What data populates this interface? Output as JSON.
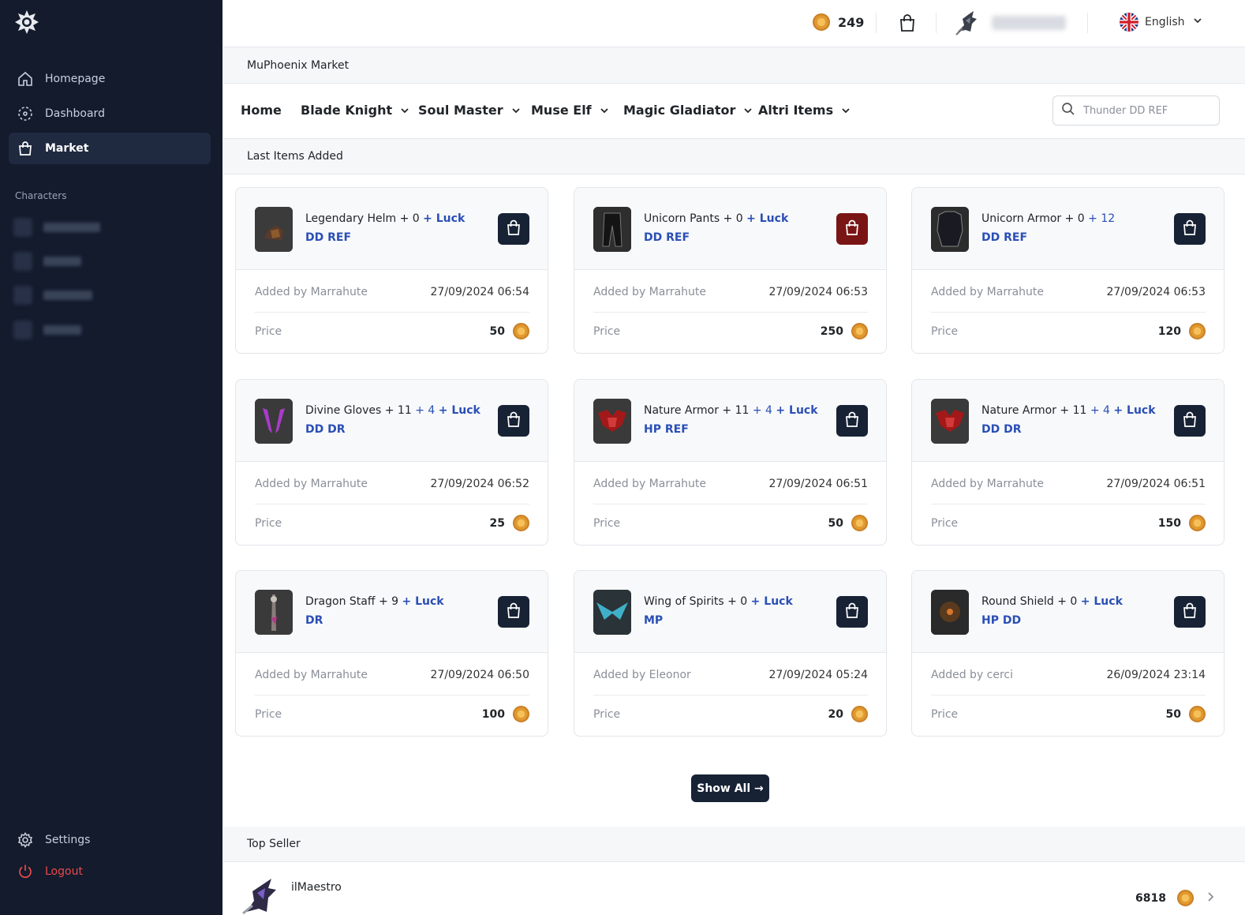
{
  "sidebar": {
    "nav": [
      {
        "label": "Homepage",
        "icon": "home-icon"
      },
      {
        "label": "Dashboard",
        "icon": "dashboard-icon"
      },
      {
        "label": "Market",
        "icon": "bag-icon",
        "active": true
      }
    ],
    "characters_title": "Characters",
    "settings_label": "Settings",
    "logout_label": "Logout"
  },
  "topbar": {
    "coins": "249",
    "language": "English"
  },
  "breadcrumb": "MuPhoenix Market",
  "categories": [
    "Home",
    "Blade Knight",
    "Soul Master",
    "Muse Elf",
    "Magic Gladiator",
    "Altri Items"
  ],
  "search": {
    "placeholder": "Thunder DD REF"
  },
  "last_items_title": "Last Items Added",
  "items": [
    {
      "name": "Legendary Helm + 0",
      "mid": "",
      "extra": "+ Luck",
      "options": "DD REF",
      "added_by": "Added by Marrahute",
      "date": "27/09/2024 06:54",
      "price_label": "Price",
      "price": "50",
      "button": "dark"
    },
    {
      "name": "Unicorn Pants + 0",
      "mid": "",
      "extra": "+ Luck",
      "options": "DD REF",
      "added_by": "Added by Marrahute",
      "date": "27/09/2024 06:53",
      "price_label": "Price",
      "price": "250",
      "button": "red"
    },
    {
      "name": "Unicorn Armor + 0",
      "mid": "+ 12",
      "extra": "",
      "options": "DD REF",
      "added_by": "Added by Marrahute",
      "date": "27/09/2024 06:53",
      "price_label": "Price",
      "price": "120",
      "button": "dark"
    },
    {
      "name": "Divine Gloves + 11",
      "mid": "+ 4",
      "extra": "+ Luck",
      "options": "DD DR",
      "added_by": "Added by Marrahute",
      "date": "27/09/2024 06:52",
      "price_label": "Price",
      "price": "25",
      "button": "dark"
    },
    {
      "name": "Nature Armor + 11",
      "mid": "+ 4",
      "extra": "+ Luck",
      "options": "HP REF",
      "added_by": "Added by Marrahute",
      "date": "27/09/2024 06:51",
      "price_label": "Price",
      "price": "50",
      "button": "dark"
    },
    {
      "name": "Nature Armor + 11",
      "mid": "+ 4",
      "extra": "+ Luck",
      "options": "DD DR",
      "added_by": "Added by Marrahute",
      "date": "27/09/2024 06:51",
      "price_label": "Price",
      "price": "150",
      "button": "dark"
    },
    {
      "name": "Dragon Staff + 9",
      "mid": "",
      "extra": "+ Luck",
      "options": "DR",
      "added_by": "Added by Marrahute",
      "date": "27/09/2024 06:50",
      "price_label": "Price",
      "price": "100",
      "button": "dark"
    },
    {
      "name": "Wing of Spirits + 0",
      "mid": "",
      "extra": "+ Luck",
      "options": "MP",
      "added_by": "Added by Eleonor",
      "date": "27/09/2024 05:24",
      "price_label": "Price",
      "price": "20",
      "button": "dark"
    },
    {
      "name": "Round Shield + 0",
      "mid": "",
      "extra": "+ Luck",
      "options": "HP DD",
      "added_by": "Added by cerci",
      "date": "26/09/2024 23:14",
      "price_label": "Price",
      "price": "50",
      "button": "dark"
    }
  ],
  "show_all_label": "Show All →",
  "top_seller_title": "Top Seller",
  "top_seller": {
    "name": "ilMaestro",
    "value": "6818"
  },
  "colors": {
    "sidebar": "#131b2d",
    "accent_blue": "#2a4fb5",
    "button_dark": "#172235",
    "button_red": "#7a1515",
    "logout": "#e94a4a"
  }
}
